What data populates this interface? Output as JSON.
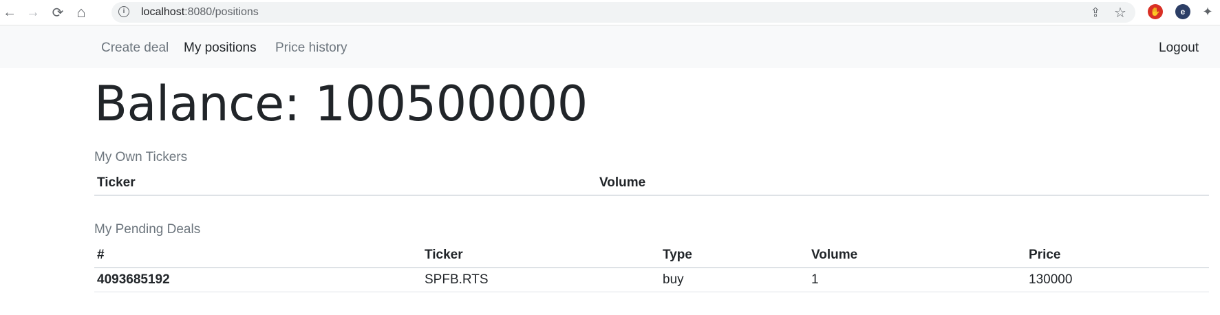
{
  "browser": {
    "url_host": "localhost",
    "url_path": ":8080/positions",
    "back_icon": "←",
    "forward_icon": "→",
    "reload_icon": "⟳",
    "home_icon": "⌂",
    "info_icon": "i",
    "share_icon": "⇪",
    "star_icon": "☆",
    "ext1_icon": "✋",
    "ext2_icon": "e",
    "puzzle_icon": "✦"
  },
  "nav": {
    "create_deal": "Create deal",
    "my_positions": "My positions",
    "price_history": "Price history",
    "logout": "Logout"
  },
  "balance_text": "Balance: 100500000",
  "own_tickers": {
    "title": "My Own Tickers",
    "headers": [
      "Ticker",
      "Volume"
    ]
  },
  "pending_deals": {
    "title": "My Pending Deals",
    "headers": [
      "#",
      "Ticker",
      "Type",
      "Volume",
      "Price"
    ],
    "rows": [
      [
        "4093685192",
        "SPFB.RTS",
        "buy",
        "1",
        "130000"
      ]
    ]
  }
}
